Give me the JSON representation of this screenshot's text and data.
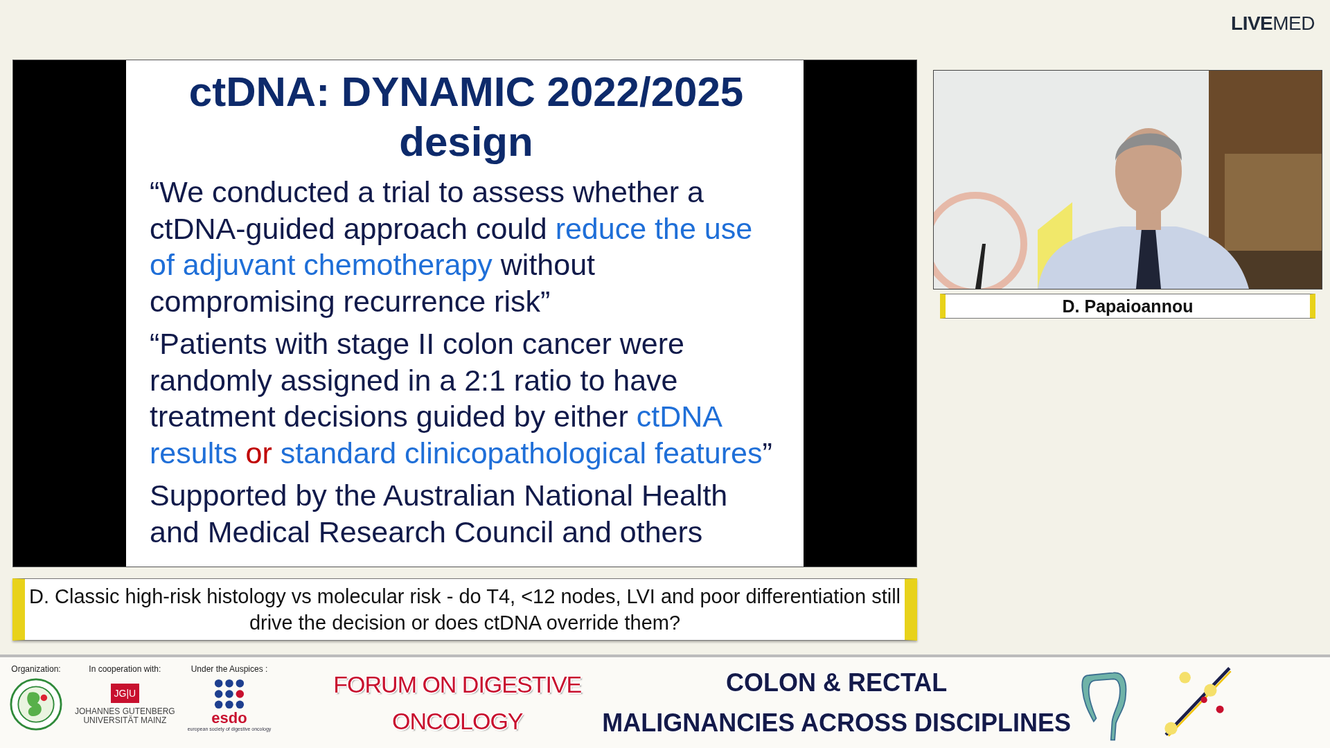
{
  "brand": {
    "logo": "**LIVE**MED"
  },
  "slide": {
    "title": "ctDNA: DYNAMIC 2022/2025 design",
    "paragraphs": [
      {
        "segments": [
          {
            "text": "“We conducted a trial to assess whether a ctDNA-guided approach could ",
            "color": "#111a4a"
          },
          {
            "text": "reduce the use of adjuvant chemotherapy",
            "color": "#1f6fd8"
          },
          {
            "text": " without compromising recurrence risk”",
            "color": "#111a4a"
          }
        ]
      },
      {
        "segments": [
          {
            "text": "“Patients with stage II colon cancer were randomly assigned in a 2:1 ratio to have treatment decisions guided by either ",
            "color": "#111a4a"
          },
          {
            "text": "ctDNA results",
            "color": "#1f6fd8"
          },
          {
            "text": " or ",
            "color": "#c00000"
          },
          {
            "text": "standard clinicopathological features",
            "color": "#1f6fd8"
          },
          {
            "text": "”",
            "color": "#111a4a"
          }
        ]
      },
      {
        "segments": [
          {
            "text": "Supported by the Australian National Health and Medical Research Council and others",
            "color": "#111a4a"
          }
        ]
      }
    ]
  },
  "speaker": {
    "name": "D. Papaioannou"
  },
  "caption": {
    "text": "D. Classic high-risk histology vs molecular risk - do T4, <12 nodes, LVI and poor differentiation still drive the decision or does ctDNA override them?"
  },
  "banner": {
    "partners": [
      {
        "label": "Organization:",
        "kind": "seal"
      },
      {
        "label": "In cooperation with:",
        "kind": "university",
        "mark": "JG|U",
        "lines": [
          "JOHANNES GUTENBERG",
          "UNIVERSITÄT MAINZ"
        ]
      },
      {
        "label": "Under the Auspices :",
        "kind": "society",
        "mark": "esdo",
        "lines": [
          "european society of digestive oncology"
        ]
      }
    ],
    "forum_title": [
      "FORUM ON DIGESTIVE",
      "ONCOLOGY"
    ],
    "event_title": [
      "COLON & RECTAL",
      "MALIGNANCIES ACROSS DISCIPLINES"
    ]
  }
}
